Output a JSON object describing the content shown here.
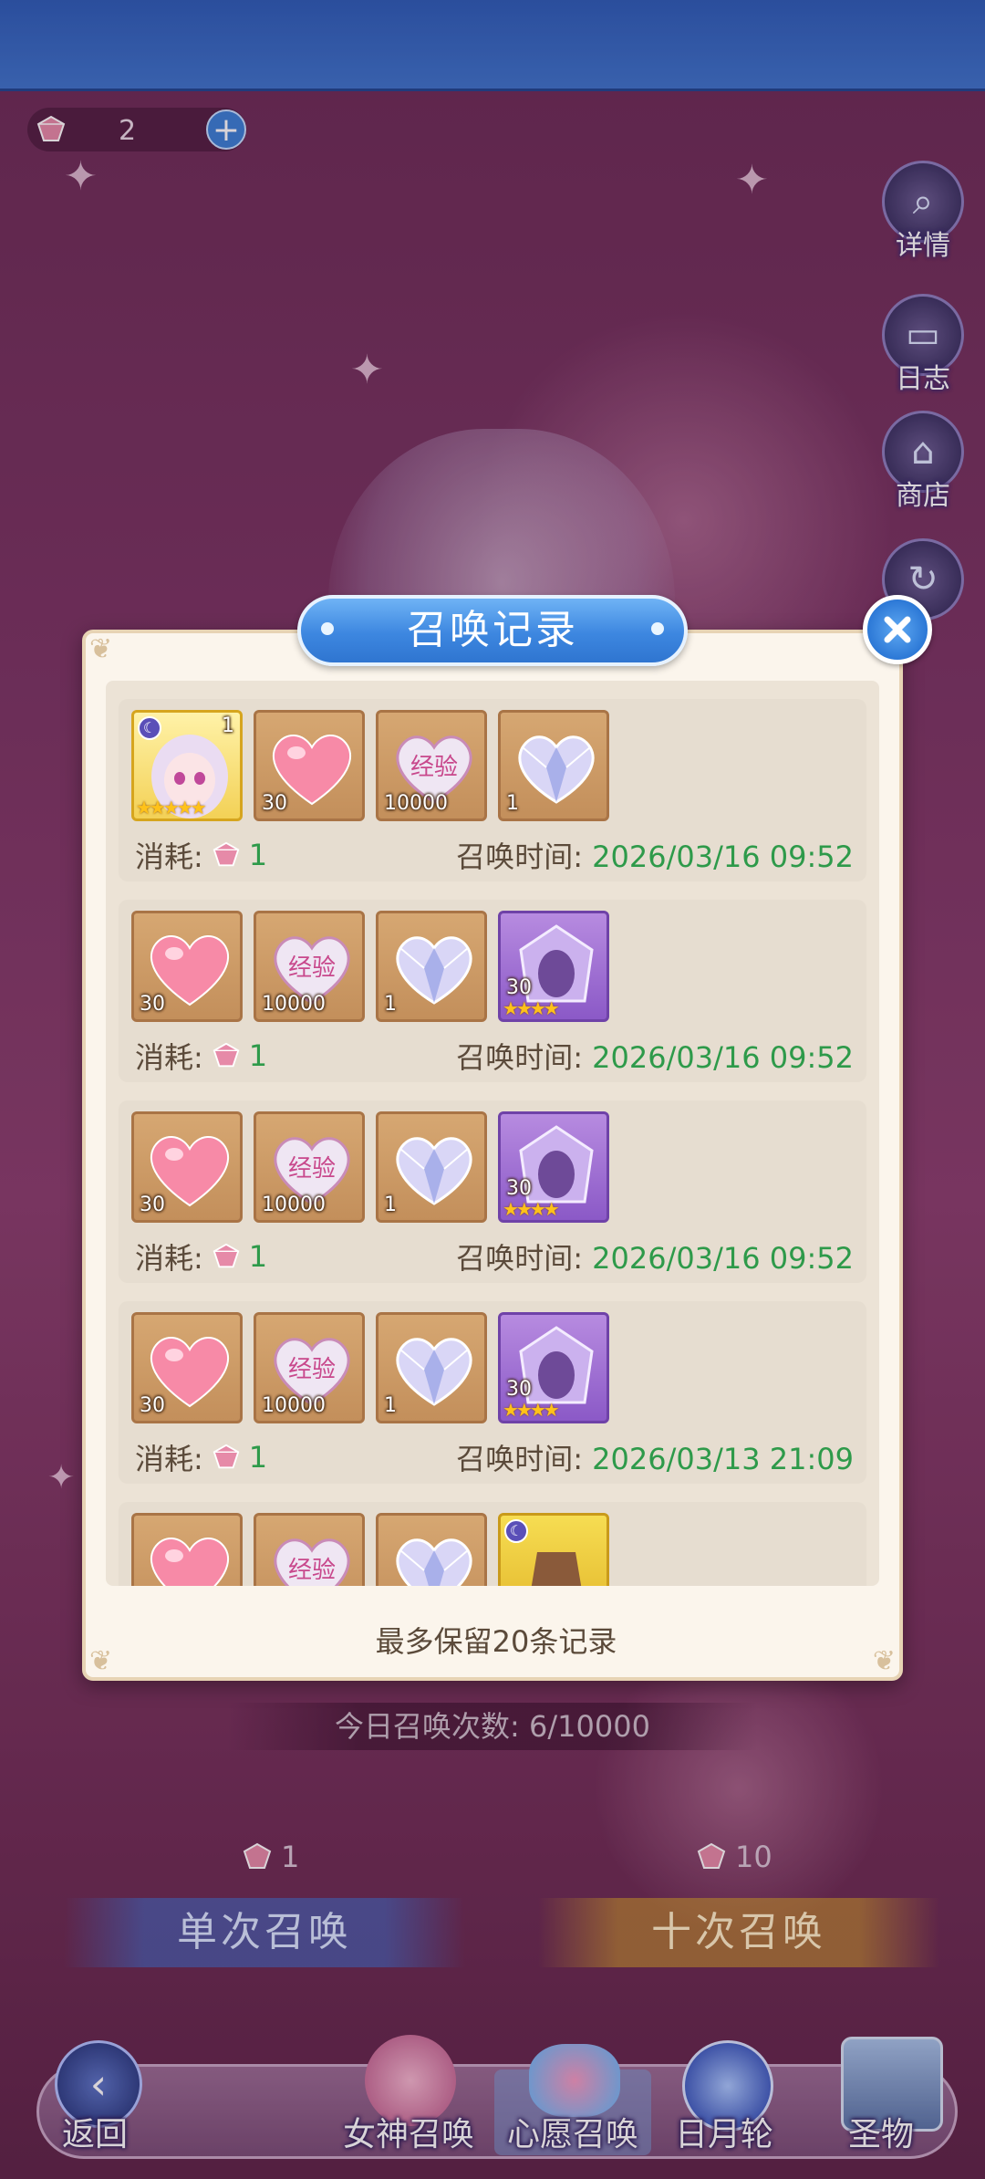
{
  "currency": {
    "amount": "2"
  },
  "side_menu": [
    {
      "label": "详情",
      "icon": "search-icon"
    },
    {
      "label": "日志",
      "icon": "book-icon"
    },
    {
      "label": "商店",
      "icon": "shop-icon"
    }
  ],
  "summon_panel": {
    "daily_count": "今日召唤次数: 6/10000",
    "single_cost": "1",
    "ten_cost": "10",
    "single_label": "单次召唤",
    "ten_label": "十次召唤"
  },
  "bottom_nav": [
    {
      "label": "返回",
      "icon": "back-icon"
    },
    {
      "label": "女神召唤",
      "icon": "goddess-portrait-icon"
    },
    {
      "label": "心愿召唤",
      "icon": "heart-wish-icon",
      "active": true
    },
    {
      "label": "日月轮",
      "icon": "compass-icon"
    },
    {
      "label": "圣物",
      "icon": "relic-chest-icon"
    }
  ],
  "modal": {
    "title": "召唤记录",
    "cost_label": "消耗:",
    "time_label": "召唤时间:",
    "footer": "最多保留20条记录",
    "records": [
      {
        "cost": "1",
        "time": "2026/03/16 09:52",
        "items": [
          {
            "type": "hero",
            "qty": "1",
            "stars": "★★★★★"
          },
          {
            "type": "heart",
            "qty": "30"
          },
          {
            "type": "exp",
            "qty": "10000"
          },
          {
            "type": "crystal-heart",
            "qty": "1"
          }
        ]
      },
      {
        "cost": "1",
        "time": "2026/03/16 09:52",
        "items": [
          {
            "type": "heart",
            "qty": "30"
          },
          {
            "type": "exp",
            "qty": "10000"
          },
          {
            "type": "crystal-heart",
            "qty": "1"
          },
          {
            "type": "fragment",
            "qty": "30",
            "stars": "★★★★"
          }
        ]
      },
      {
        "cost": "1",
        "time": "2026/03/16 09:52",
        "items": [
          {
            "type": "heart",
            "qty": "30"
          },
          {
            "type": "exp",
            "qty": "10000"
          },
          {
            "type": "crystal-heart",
            "qty": "1"
          },
          {
            "type": "fragment",
            "qty": "30",
            "stars": "★★★★"
          }
        ]
      },
      {
        "cost": "1",
        "time": "2026/03/13 21:09",
        "items": [
          {
            "type": "heart",
            "qty": "30"
          },
          {
            "type": "exp",
            "qty": "10000"
          },
          {
            "type": "crystal-heart",
            "qty": "1"
          },
          {
            "type": "fragment",
            "qty": "30",
            "stars": "★★★★"
          }
        ]
      },
      {
        "items": [
          {
            "type": "heart"
          },
          {
            "type": "exp"
          },
          {
            "type": "crystal-heart"
          },
          {
            "type": "gold-item"
          }
        ]
      }
    ],
    "exp_text": "经验"
  },
  "colors": {
    "accent_blue": "#3d87e0",
    "value_green": "#2e9a4a",
    "text_brown": "#5b4a3a",
    "modal_bg": "#fbf5ec"
  }
}
